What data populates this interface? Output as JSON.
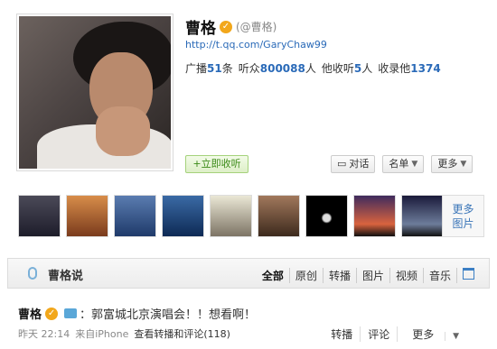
{
  "profile": {
    "name": "曹格",
    "handle": "(@曹格)",
    "url": "http://t.qq.com/GaryChaw99",
    "stats": {
      "broadcast_label": "广播",
      "broadcast_num": "51",
      "broadcast_unit": "条",
      "listeners_label": "听众",
      "listeners_num": "800088",
      "listeners_unit": "人",
      "following_label": "他收听",
      "following_num": "5",
      "following_unit": "人",
      "collected_label": "收录他",
      "collected_num": "1374"
    },
    "follow_label": "+立即收听",
    "actions": {
      "chat": "对话",
      "list": "名单",
      "more": "更多"
    }
  },
  "photos": {
    "more_label_1": "更多",
    "more_label_2": "图片"
  },
  "feed": {
    "title": "曹格说",
    "filters": [
      "全部",
      "原创",
      "转播",
      "图片",
      "视频",
      "音乐"
    ]
  },
  "post": {
    "author": "曹格",
    "content": "：郭富城北京演唱会！！想看啊！",
    "time": "昨天 22:14",
    "source": "来自iPhone",
    "view_label": "查看转播和评论(",
    "view_count": "118",
    "view_close": ")",
    "actions": [
      "转播",
      "评论",
      "更多"
    ]
  }
}
